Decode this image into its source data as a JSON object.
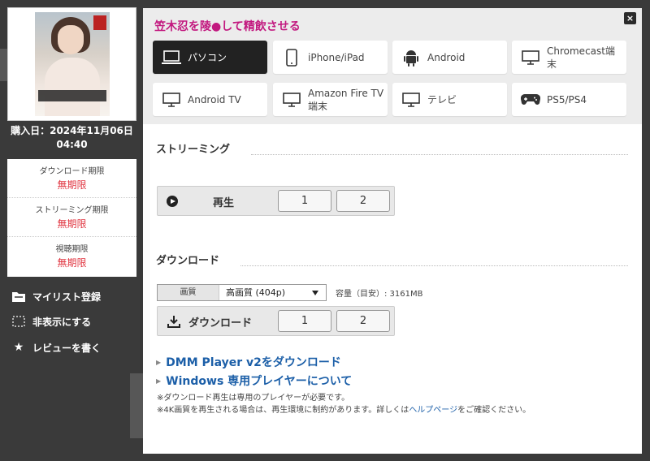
{
  "left_panel": {
    "purchase_date": "購入日：2024年11月06日 04:40",
    "limits": [
      {
        "label": "ダウンロード期限",
        "value": "無期限"
      },
      {
        "label": "ストリーミング期限",
        "value": "無期限"
      },
      {
        "label": "視聴期限",
        "value": "無期限"
      }
    ],
    "links": [
      {
        "label": "マイリスト登録",
        "icon": "folder-icon"
      },
      {
        "label": "非表示にする",
        "icon": "dashed-box-icon"
      },
      {
        "label": "レビューを書く",
        "icon": "star-icon"
      }
    ]
  },
  "modal": {
    "title": "笠木忍を陵●して精飲させる",
    "close_label": "×",
    "devices": [
      {
        "label": "パソコン",
        "icon": "laptop-icon",
        "active": true
      },
      {
        "label": "iPhone/iPad",
        "icon": "phone-icon",
        "active": false
      },
      {
        "label": "Android",
        "icon": "android-icon",
        "active": false
      },
      {
        "label": "Chromecast端末",
        "icon": "monitor-icon",
        "active": false
      },
      {
        "label": "Android TV",
        "icon": "monitor-icon",
        "active": false
      },
      {
        "label": "Amazon Fire TV端末",
        "icon": "monitor-icon",
        "active": false
      },
      {
        "label": "テレビ",
        "icon": "monitor-icon",
        "active": false
      },
      {
        "label": "PS5/PS4",
        "icon": "gamepad-icon",
        "active": false
      }
    ],
    "streaming": {
      "heading": "ストリーミング",
      "play_label": "再生",
      "parts": [
        "1",
        "2"
      ]
    },
    "download": {
      "heading": "ダウンロード",
      "quality_label": "画質",
      "quality_value": "高画質 (404p)",
      "capacity": "容量（目安）: 3161MB",
      "download_label": "ダウンロード",
      "parts": [
        "1",
        "2"
      ]
    },
    "links": [
      "DMM Player v2をダウンロード",
      "Windows 専用プレイヤーについて"
    ],
    "notes": {
      "note1": "※ダウンロード再生は専用のプレイヤーが必要です。",
      "note2_before": "※4K画質を再生される場合は、再生環境に制約があります。詳しくは",
      "note2_link": "ヘルプページ",
      "note2_after": "をご確認ください。"
    }
  },
  "colors": {
    "accent_title": "#c2187f",
    "limit_value": "#e0343f",
    "link": "#1c5fa8",
    "active_device": "#222222"
  }
}
